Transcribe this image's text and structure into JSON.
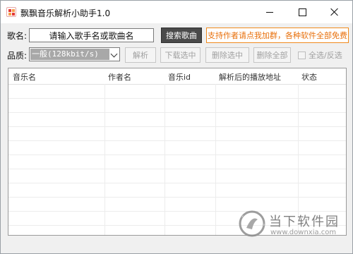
{
  "window": {
    "title": "飘飘音乐解析小助手1.0"
  },
  "search": {
    "song_label": "歌名:",
    "input_value": "请输入歌手名或歌曲名",
    "search_button": "搜索歌曲",
    "promo_link": "支持作者请点我加群，各种软件全部免费",
    "promo_color": "#e8700c"
  },
  "toolbar": {
    "quality_label": "品质:",
    "quality_value": "一般(128kbit/s)",
    "parse_button": "解析",
    "download_selected_button": "下载选中",
    "delete_selected_button": "删除选中",
    "delete_all_button": "删除全部",
    "select_all_label": "全选/反选"
  },
  "table": {
    "columns": [
      "音乐名",
      "作者名",
      "音乐id",
      "解析后的播放地址",
      "状态"
    ]
  },
  "watermark": {
    "title": "当下软件园",
    "url": "www.downxia.com"
  },
  "colors": {
    "search_button_bg": "#4a4a4a",
    "promo_border": "#f08a1c",
    "selected_quality_bg": "#a8a8a8"
  }
}
